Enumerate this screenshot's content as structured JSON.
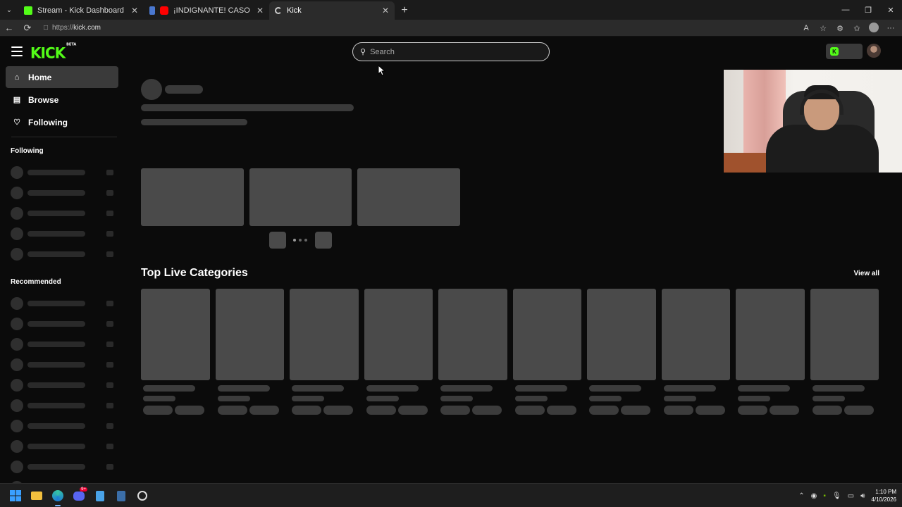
{
  "browser": {
    "tabs": [
      {
        "title": "Stream - Kick Dashboard",
        "active": false,
        "favicon_color": "#53fc18"
      },
      {
        "title": "¡INDIGNANTE! CASO SMASH Y DE",
        "active": false,
        "favicon_color": "#ff0000"
      },
      {
        "title": "Kick",
        "active": true,
        "favicon_color": "#dddddd"
      }
    ],
    "new_tab_symbol": "+",
    "url_scheme": "https://",
    "url_host": "kick.com"
  },
  "kick": {
    "logo_text": "KICK",
    "logo_badge": "BETA",
    "search_placeholder": "Search",
    "brand_color": "#53fc18",
    "k_badge_letter": "K"
  },
  "sidebar": {
    "nav": [
      {
        "label": "Home",
        "icon": "home-icon",
        "active": true
      },
      {
        "label": "Browse",
        "icon": "browse-icon",
        "active": false
      },
      {
        "label": "Following",
        "icon": "heart-icon",
        "active": false
      }
    ],
    "following_heading": "Following",
    "recommended_heading": "Recommended"
  },
  "main": {
    "section_title": "Top Live Categories",
    "view_all_label": "View all"
  },
  "taskbar": {
    "time": "1:10 PM",
    "date": "4/10/2026",
    "discord_badge": "9+"
  }
}
